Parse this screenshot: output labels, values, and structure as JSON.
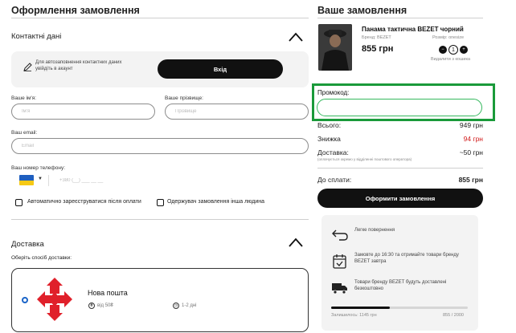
{
  "checkout": {
    "title": "Оформлення замовлення",
    "contact": {
      "title": "Контактні дані",
      "autofill_text": "Для автозаповнення контактних даних увійдіть в акаунт",
      "login_label": "Вхід"
    },
    "fields": {
      "first_name_label": "Ваше ім'я:",
      "first_name_placeholder": "Ім'я",
      "last_name_label": "Ваше прізвище:",
      "last_name_placeholder": "Прізвище",
      "email_label": "Ваш email:",
      "email_placeholder": "Email",
      "phone_label": "Ваш номер телефону:",
      "phone_placeholder": "+380 (__) ___ __ __"
    },
    "checkboxes": {
      "auto_register": "Автоматично зареєструватися після оплати",
      "other_recipient": "Одержувач замовлення інша людина"
    },
    "delivery": {
      "title": "Доставка",
      "subtitle": "Оберіть спосіб доставки:",
      "option_name": "Нова пошта",
      "option_price": "від 50₴",
      "option_time": "1-2 дні"
    }
  },
  "order": {
    "title": "Ваше замовлення",
    "product": {
      "name": "Панама тактична BEZET чорний",
      "brand_label": "Бренд: BEZET",
      "size_label": "Розмір: onesize",
      "price": "855 грн",
      "quantity": "1",
      "remove_label": "Видалити з кошика"
    },
    "promo_label": "Промокод:",
    "summary": {
      "total_label": "Всього:",
      "total_value": "949 грн",
      "discount_label": "Знижка",
      "discount_value": "94 грн",
      "delivery_label": "Доставка:",
      "delivery_value": "~50 грн",
      "delivery_note": "(оплачується окремо у відділенні поштового оператора)",
      "pay_label": "До сплати:",
      "pay_value": "855 грн"
    },
    "checkout_label": "Оформити замовлення",
    "benefits": {
      "easy_return": "Легке повернення",
      "next_day": "Замовте до 16:30 та отримайте товари бренду BEZET завтра",
      "free_delivery": "Товари бренду BEZET будуть доставлені безкоштовно",
      "progress_left": "Залишилось: 1145 грн",
      "progress_right": "855 / 2000",
      "progress_fraction": 0.4275
    }
  },
  "colors": {
    "accent_green": "#1a9a3a",
    "discount_red": "#d11a1a",
    "radio_blue": "#1a64c8",
    "np_red": "#e0202a"
  }
}
